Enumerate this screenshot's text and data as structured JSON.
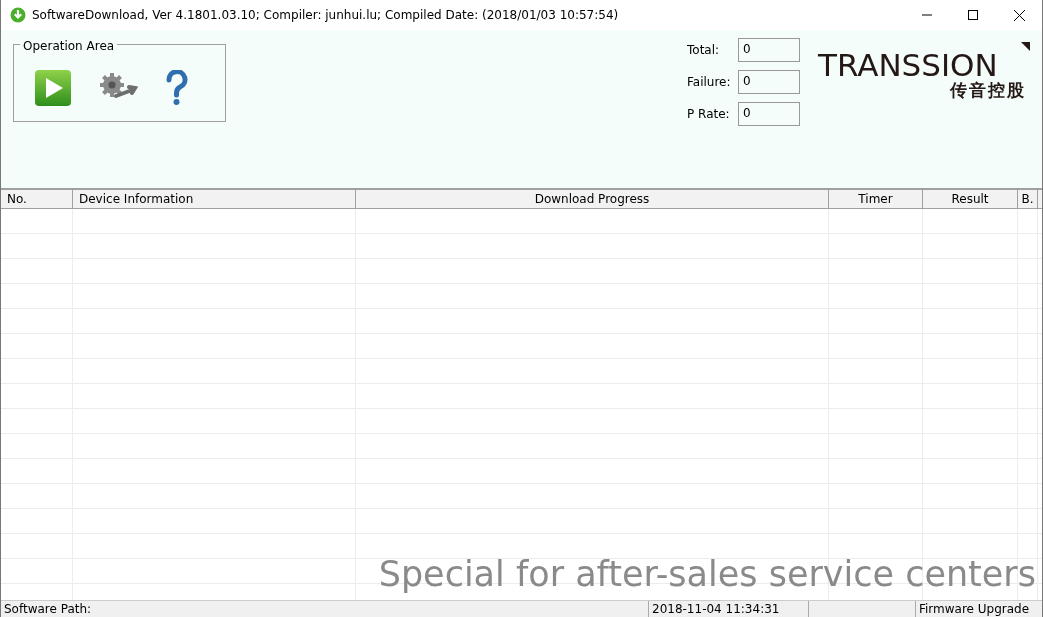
{
  "window": {
    "title": "SoftwareDownload, Ver 4.1801.03.10; Compiler: junhui.lu; Compiled Date: (2018/01/03 10:57:54)"
  },
  "operation_area": {
    "title": "Operation Area",
    "buttons": [
      {
        "kind": "start"
      },
      {
        "kind": "settings"
      },
      {
        "kind": "help"
      }
    ]
  },
  "counters": [
    {
      "label": "Total:",
      "value": "0"
    },
    {
      "label": "Failure:",
      "value": "0"
    },
    {
      "label": "P Rate:",
      "value": "0"
    }
  ],
  "logo": {
    "name": "TRANSSION",
    "subtitle": "传音控股"
  },
  "table": {
    "columns": [
      "No.",
      "Device Information",
      "Download Progress",
      "Timer",
      "Result",
      "B."
    ]
  },
  "banner": "Special for after-sales service centers",
  "status_bar": {
    "path_label": "Software Path:",
    "datetime": "2018-11-04 11:34:31",
    "mode": "Firmware Upgrade"
  }
}
